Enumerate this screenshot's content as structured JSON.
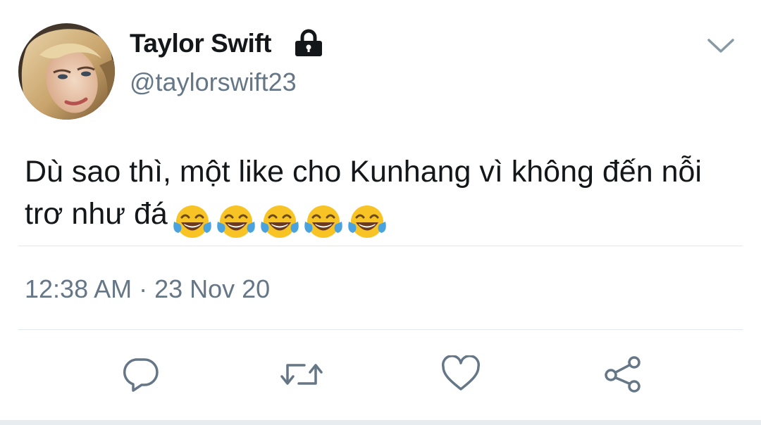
{
  "tweet": {
    "display_name": "Taylor Swift",
    "handle": "@taylorswift23",
    "text": "Dù sao thì, một like cho Kunhang vì không đến nỗi trơ như đá",
    "emojis": [
      "face-with-tears-of-joy",
      "face-with-tears-of-joy",
      "face-with-tears-of-joy",
      "face-with-tears-of-joy",
      "face-with-tears-of-joy"
    ],
    "timestamp": "12:38 AM · 23 Nov 20",
    "protected_account": true
  },
  "icons": {
    "lock": "lock-icon",
    "menu": "chevron-down-icon",
    "reply": "reply-icon",
    "retweet": "retweet-icon",
    "like": "heart-icon",
    "share": "share-icon"
  },
  "colors": {
    "text_primary": "#14171a",
    "text_secondary": "#657786",
    "divider": "#e1e8ed",
    "icon": "#657786"
  }
}
